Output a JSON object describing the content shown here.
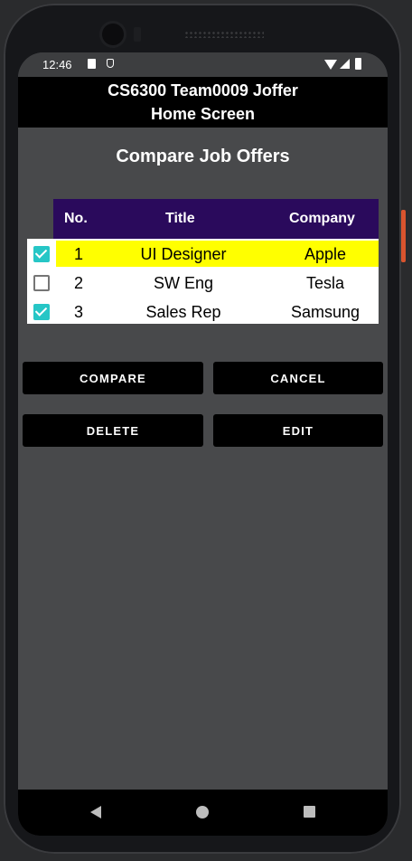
{
  "status_bar": {
    "time": "12:46"
  },
  "app_bar": {
    "line1": "CS6300 Team0009 Joffer",
    "line2": "Home Screen"
  },
  "section_title": "Compare Job Offers",
  "table": {
    "headers": {
      "no": "No.",
      "title": "Title",
      "company": "Company"
    },
    "header_color": "#2a0a5c",
    "highlight_color": "#ffff00",
    "rows": [
      {
        "no": "1",
        "title": "UI Designer",
        "company": "Apple",
        "checked": true,
        "highlighted": true
      },
      {
        "no": "2",
        "title": "SW Eng",
        "company": "Tesla",
        "checked": false,
        "highlighted": false
      },
      {
        "no": "3",
        "title": "Sales Rep",
        "company": "Samsung",
        "checked": true,
        "highlighted": false
      }
    ]
  },
  "buttons": {
    "compare": "COMPARE",
    "cancel": "CANCEL",
    "delete": "DELETE",
    "edit": "EDIT"
  },
  "accent_color": "#26c6c6"
}
